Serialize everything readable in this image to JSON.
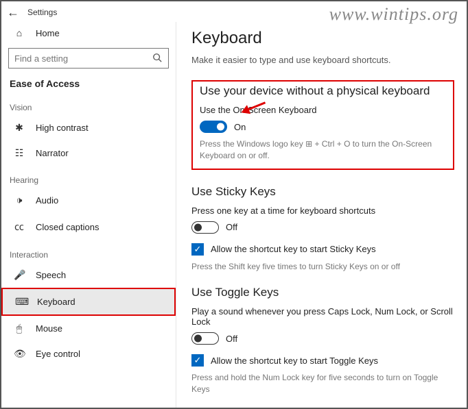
{
  "titlebar": {
    "title": "Settings"
  },
  "watermark": "www.wintips.org",
  "sidebar": {
    "home": "Home",
    "search_placeholder": "Find a setting",
    "header": "Ease of Access",
    "groups": [
      {
        "label": "Vision",
        "items": [
          {
            "icon": "sparkle-icon",
            "label": "High contrast"
          },
          {
            "icon": "narrator-icon",
            "label": "Narrator"
          }
        ]
      },
      {
        "label": "Hearing",
        "items": [
          {
            "icon": "audio-icon",
            "label": "Audio"
          },
          {
            "icon": "captions-icon",
            "label": "Closed captions"
          }
        ]
      },
      {
        "label": "Interaction",
        "items": [
          {
            "icon": "speech-icon",
            "label": "Speech"
          },
          {
            "icon": "keyboard-icon",
            "label": "Keyboard",
            "selected": true,
            "red": true
          },
          {
            "icon": "mouse-icon",
            "label": "Mouse"
          },
          {
            "icon": "eye-icon",
            "label": "Eye control"
          }
        ]
      }
    ]
  },
  "main": {
    "title": "Keyboard",
    "subtitle": "Make it easier to type and use keyboard shortcuts.",
    "osk": {
      "section_title": "Use your device without a physical keyboard",
      "label": "Use the On-Screen Keyboard",
      "state": "On",
      "hint": "Press the Windows logo key ⊞ + Ctrl + O to turn the On-Screen Keyboard on or off."
    },
    "sticky": {
      "section_title": "Use Sticky Keys",
      "label": "Press one key at a time for keyboard shortcuts",
      "state": "Off",
      "check_label": "Allow the shortcut key to start Sticky Keys",
      "hint": "Press the Shift key five times to turn Sticky Keys on or off"
    },
    "toggle": {
      "section_title": "Use Toggle Keys",
      "label": "Play a sound whenever you press Caps Lock, Num Lock, or Scroll Lock",
      "state": "Off",
      "check_label": "Allow the shortcut key to start Toggle Keys",
      "hint": "Press and hold the Num Lock key for five seconds to turn on Toggle Keys"
    }
  }
}
